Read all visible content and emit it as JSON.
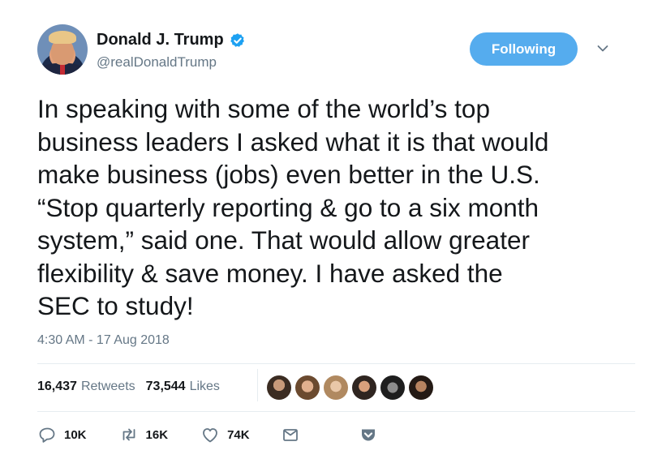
{
  "author": {
    "name": "Donald J. Trump",
    "handle": "@realDonaldTrump",
    "verified": true,
    "follow_label": "Following"
  },
  "tweet": {
    "text": "In speaking with some of the world’s top\nbusiness leaders I asked what it is that would\nmake business (jobs) even better in the U.S.\n“Stop quarterly reporting & go to a six month\nsystem,” said one. That would allow greater\nflexibility & save money. I have asked the\nSEC to study!",
    "timestamp": "4:30 AM - 17 Aug 2018"
  },
  "stats": {
    "retweets_count": "16,437",
    "retweets_label": "Retweets",
    "likes_count": "73,544",
    "likes_label": "Likes"
  },
  "actions": {
    "reply_count": "10K",
    "retweet_count": "16K",
    "like_count": "74K"
  },
  "colors": {
    "accent": "#55acee",
    "muted": "#657786",
    "text": "#14171a",
    "divider": "#e6ecf0"
  }
}
